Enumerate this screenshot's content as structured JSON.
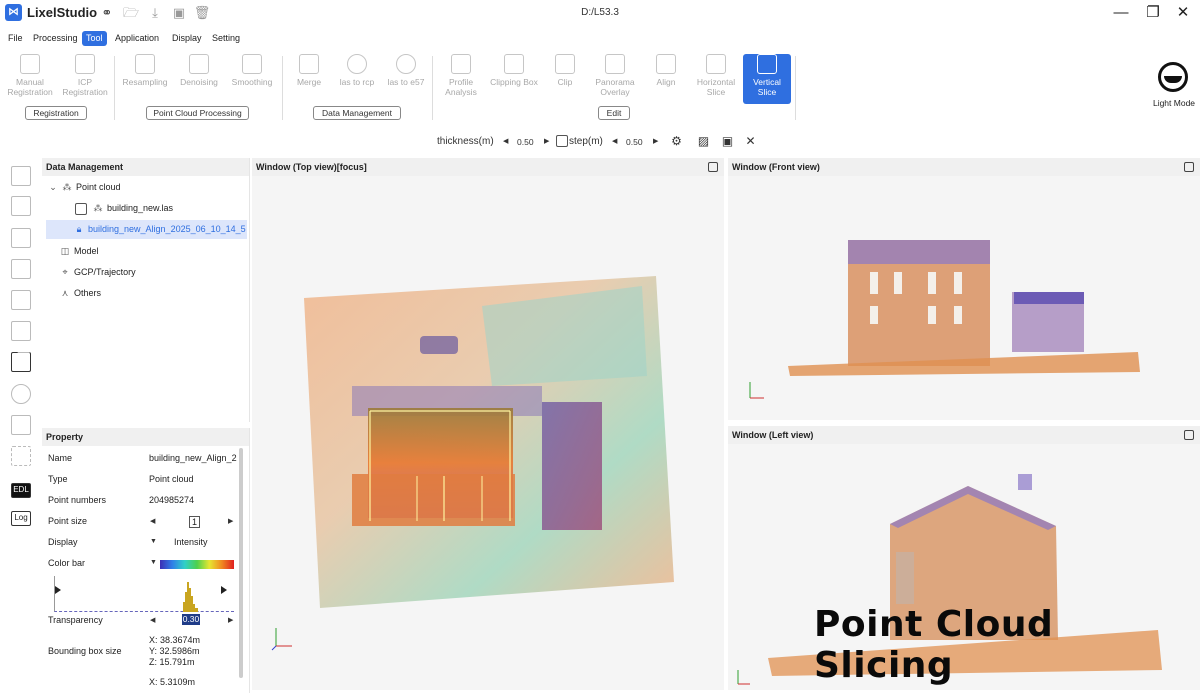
{
  "app": {
    "name": "LixelStudio",
    "window_title": "D:/L53.3"
  },
  "menu": [
    "File",
    "Processing",
    "Tool",
    "Application",
    "Display",
    "Setting"
  ],
  "menu_active": "Tool",
  "ribbon": {
    "buttons": [
      {
        "line1": "Manual",
        "line2": "Registration"
      },
      {
        "line1": "ICP",
        "line2": "Registration"
      },
      {
        "line1": "Resampling",
        "line2": ""
      },
      {
        "line1": "Denoising",
        "line2": ""
      },
      {
        "line1": "Smoothing",
        "line2": ""
      },
      {
        "line1": "Merge",
        "line2": ""
      },
      {
        "line1": "las to rcp",
        "line2": ""
      },
      {
        "line1": "las to e57",
        "line2": ""
      },
      {
        "line1": "Profile",
        "line2": "Analysis"
      },
      {
        "line1": "Clipping Box",
        "line2": ""
      },
      {
        "line1": "Clip",
        "line2": ""
      },
      {
        "line1": "Panorama",
        "line2": "Overlay"
      },
      {
        "line1": "Align",
        "line2": ""
      },
      {
        "line1": "Horizontal",
        "line2": "Slice"
      },
      {
        "line1": "Vertical",
        "line2": "Slice"
      }
    ],
    "groups": [
      "Registration",
      "Point Cloud Processing",
      "Data Management",
      "Edit"
    ],
    "light_mode_label": "Light Mode"
  },
  "slice_toolbar": {
    "thickness_label": "thickness(m)",
    "thickness_value": "0.50",
    "step_label": "step(m)",
    "step_value": "0.50"
  },
  "data_management": {
    "title": "Data Management",
    "tree": [
      {
        "label": "Point cloud"
      },
      {
        "label": "building_new.las"
      },
      {
        "label": "building_new_Align_2025_06_10_14_5"
      },
      {
        "label": "Model"
      },
      {
        "label": "GCP/Trajectory"
      },
      {
        "label": "Others"
      }
    ]
  },
  "property": {
    "title": "Property",
    "name_label": "Name",
    "name_value": "building_new_Align_2",
    "type_label": "Type",
    "type_value": "Point cloud",
    "points_label": "Point numbers",
    "points_value": "204985274",
    "size_label": "Point size",
    "size_value": "1",
    "display_label": "Display",
    "display_value": "Intensity",
    "colorbar_label": "Color bar",
    "transparency_label": "Transparency",
    "transparency_value": "0.30",
    "bbox_label": "Bounding box size",
    "bbox_x": "X: 38.3674m",
    "bbox_y": "Y: 32.5986m",
    "bbox_z": "Z: 15.791m",
    "bbox_x2": "X: 5.3109m"
  },
  "viewports": {
    "top": "Window (Top view)[focus]",
    "front": "Window (Front view)",
    "left": "Window (Left view)"
  },
  "overlay_caption": "Point Cloud Slicing",
  "colors": {
    "accent": "#2f6fe0"
  }
}
